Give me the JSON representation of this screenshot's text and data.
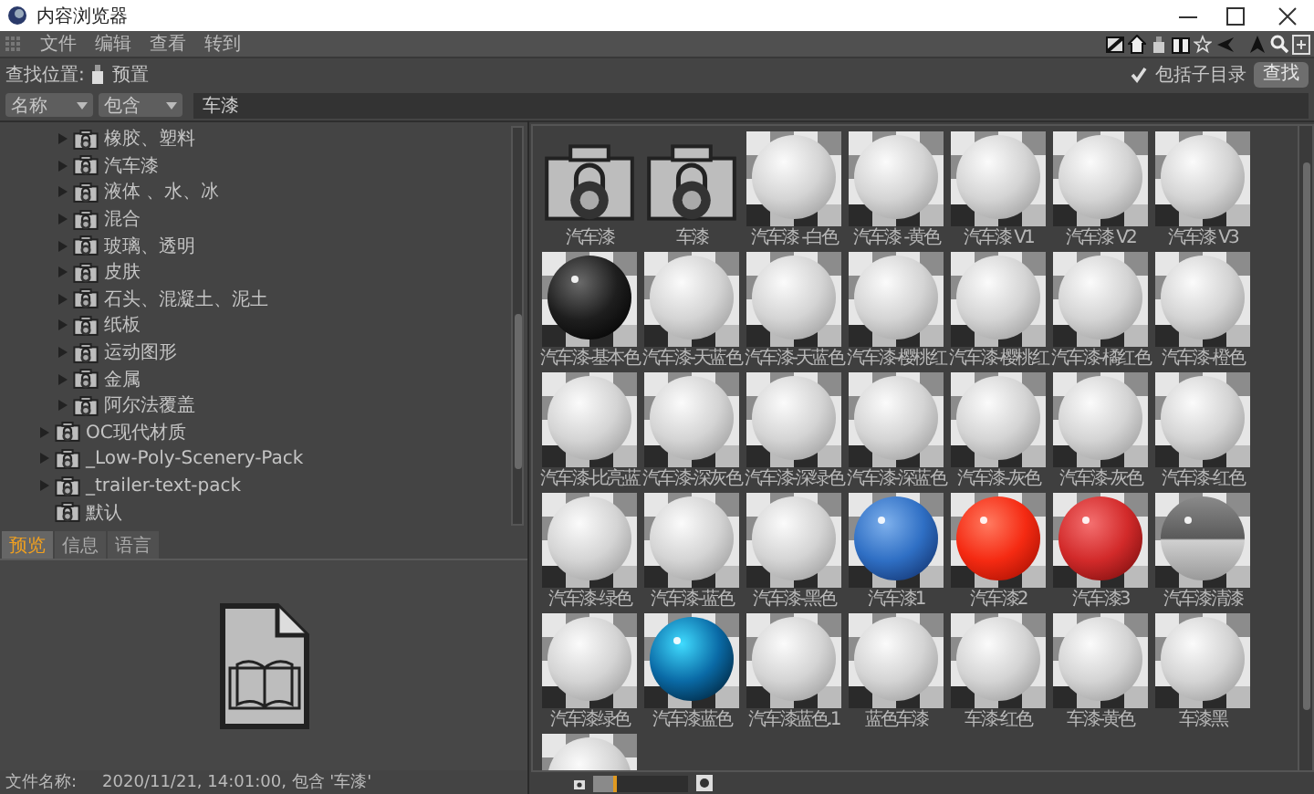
{
  "window": {
    "title": "内容浏览器"
  },
  "menu": [
    "文件",
    "编辑",
    "查看",
    "转到"
  ],
  "toolbar": {
    "search_in_label": "查找位置:",
    "search_in_value": "预置",
    "include_subdirs": {
      "label": "包括子目录",
      "checked": true
    },
    "find_button": "查找"
  },
  "filter": {
    "field": "名称",
    "mode": "包含",
    "query": "车漆"
  },
  "tree": [
    {
      "children": [
        {
          "label": "橡胶、塑料",
          "expandable": true
        },
        {
          "label": "汽车漆",
          "expandable": true
        },
        {
          "label": "液体 、水、冰",
          "expandable": true
        },
        {
          "label": "混合",
          "expandable": true
        },
        {
          "label": "玻璃、透明",
          "expandable": true
        },
        {
          "label": "皮肤",
          "expandable": true
        },
        {
          "label": "石头、混凝土、泥土",
          "expandable": true
        },
        {
          "label": "纸板",
          "expandable": true
        },
        {
          "label": "运动图形",
          "expandable": true
        },
        {
          "label": "金属",
          "expandable": true
        },
        {
          "label": "阿尔法覆盖",
          "expandable": true
        }
      ]
    },
    {
      "label": "OC现代材质",
      "expandable": true
    },
    {
      "label": "_Low-Poly-Scenery-Pack",
      "expandable": true
    },
    {
      "label": "_trailer-text-pack",
      "expandable": true
    },
    {
      "label": "默认",
      "expandable": false
    }
  ],
  "preview_tabs": [
    {
      "label": "预览",
      "selected": true
    },
    {
      "label": "信息",
      "selected": false
    },
    {
      "label": "语言",
      "selected": false
    }
  ],
  "status": {
    "label": "文件名称:",
    "value": "2020/11/21, 14:01:00, 包含 '车漆'"
  },
  "materials": [
    {
      "label": "汽车漆",
      "kind": "folder"
    },
    {
      "label": "车漆",
      "kind": "folder"
    },
    {
      "label": "汽车漆 -白色",
      "kind": "white"
    },
    {
      "label": "汽车漆 -黄色",
      "kind": "white"
    },
    {
      "label": "汽车漆 V1",
      "kind": "white"
    },
    {
      "label": "汽车漆 V2",
      "kind": "white"
    },
    {
      "label": "汽车漆 V3",
      "kind": "white"
    },
    {
      "label": "汽车漆-基本色",
      "kind": "black"
    },
    {
      "label": "汽车漆-天蓝色",
      "kind": "white"
    },
    {
      "label": "汽车漆-天蓝色",
      "kind": "white"
    },
    {
      "label": "汽车漆-樱桃红",
      "kind": "white"
    },
    {
      "label": "汽车漆-樱桃红",
      "kind": "white"
    },
    {
      "label": "汽车漆-橘红色",
      "kind": "white"
    },
    {
      "label": "汽车漆-橙色",
      "kind": "white"
    },
    {
      "label": "汽车漆-比亮蓝",
      "kind": "white"
    },
    {
      "label": "汽车漆-深灰色",
      "kind": "white"
    },
    {
      "label": "汽车漆-深绿色",
      "kind": "white"
    },
    {
      "label": "汽车漆-深蓝色",
      "kind": "white"
    },
    {
      "label": "汽车漆-灰色",
      "kind": "white"
    },
    {
      "label": "汽车漆-灰色",
      "kind": "white"
    },
    {
      "label": "汽车漆-红色",
      "kind": "white"
    },
    {
      "label": "汽车漆-绿色",
      "kind": "white"
    },
    {
      "label": "汽车漆-蓝色",
      "kind": "white"
    },
    {
      "label": "汽车漆-黑色",
      "kind": "white"
    },
    {
      "label": "汽车漆1",
      "kind": "blue"
    },
    {
      "label": "汽车漆2",
      "kind": "red"
    },
    {
      "label": "汽车漆3",
      "kind": "crimson"
    },
    {
      "label": "汽车漆清漆",
      "kind": "chrome"
    },
    {
      "label": "汽车漆绿色",
      "kind": "white"
    },
    {
      "label": "汽车漆蓝色",
      "kind": "teal"
    },
    {
      "label": "汽车漆蓝色.1",
      "kind": "white"
    },
    {
      "label": "蓝色车漆",
      "kind": "white"
    },
    {
      "label": "车漆-红色",
      "kind": "white"
    },
    {
      "label": "车漆-黄色",
      "kind": "white"
    },
    {
      "label": "车漆黑",
      "kind": "white"
    },
    {
      "kind": "white"
    }
  ],
  "zoom": {
    "level": 0.25
  }
}
